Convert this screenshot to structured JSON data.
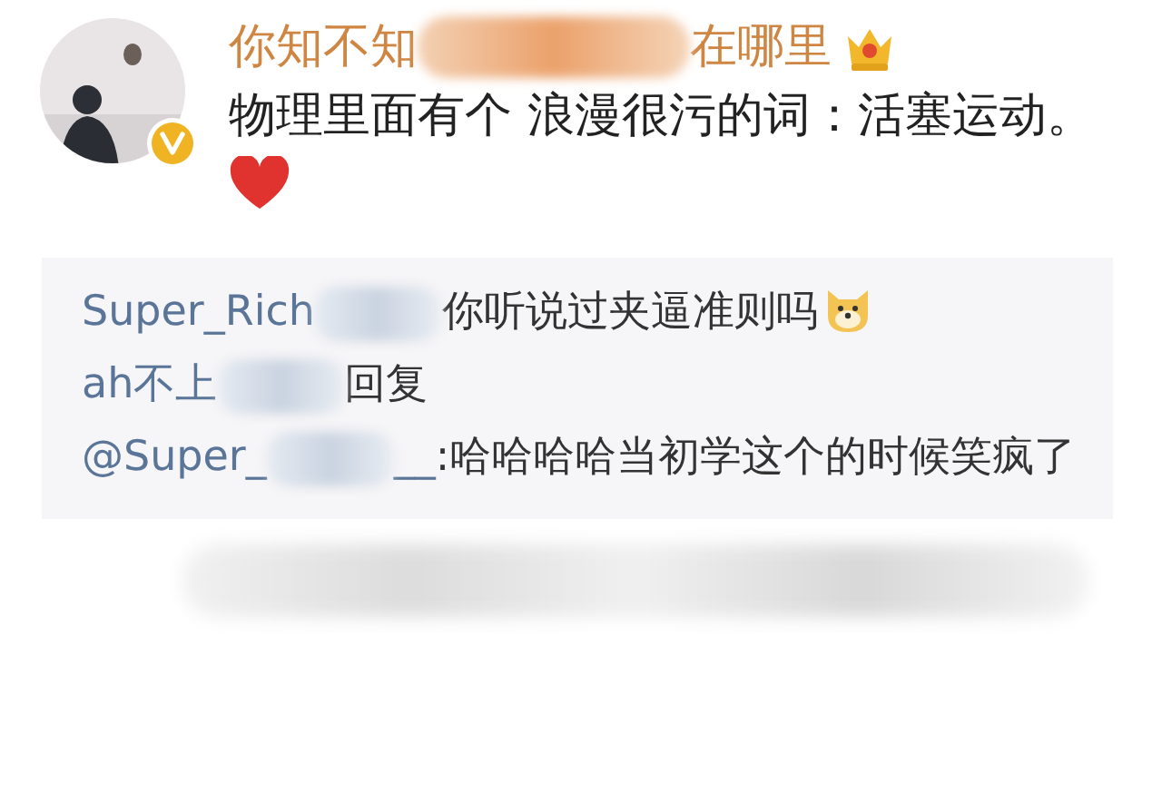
{
  "comment": {
    "username_parts": [
      "你知不知",
      "在哪里"
    ],
    "text": "物理里面有个 浪漫很污的词：活塞运动。"
  },
  "replies": [
    {
      "parts": [
        {
          "kind": "name",
          "text": "Super_Rich"
        },
        {
          "kind": "redacted"
        },
        {
          "kind": "text",
          "text": "你听说过夹逼准则吗"
        },
        {
          "kind": "emoji"
        }
      ]
    },
    {
      "parts": [
        {
          "kind": "name",
          "text": "ah不上"
        },
        {
          "kind": "redacted"
        },
        {
          "kind": "text",
          "text": "回复"
        },
        {
          "kind": "break"
        },
        {
          "kind": "name",
          "text": "@Super_"
        },
        {
          "kind": "redacted"
        },
        {
          "kind": "name",
          "text": "__"
        },
        {
          "kind": "text",
          "text": ":哈哈哈哈当初学这个的时候笑疯了"
        }
      ]
    }
  ]
}
